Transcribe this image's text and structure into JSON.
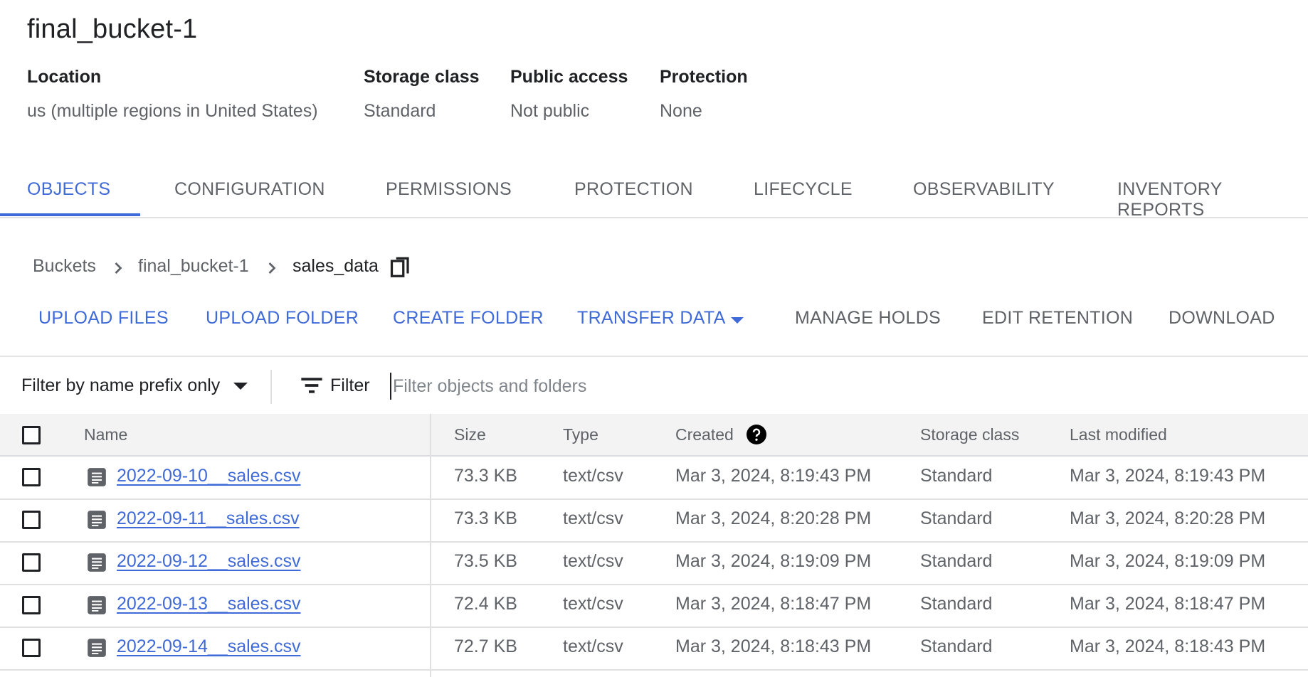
{
  "bucket": {
    "name": "final_bucket-1",
    "details": [
      {
        "label": "Location",
        "value": "us (multiple regions in United States)"
      },
      {
        "label": "Storage class",
        "value": "Standard"
      },
      {
        "label": "Public access",
        "value": "Not public"
      },
      {
        "label": "Protection",
        "value": "None"
      }
    ]
  },
  "tabs": [
    {
      "label": "OBJECTS",
      "active": true
    },
    {
      "label": "CONFIGURATION",
      "active": false
    },
    {
      "label": "PERMISSIONS",
      "active": false
    },
    {
      "label": "PROTECTION",
      "active": false
    },
    {
      "label": "LIFECYCLE",
      "active": false
    },
    {
      "label": "OBSERVABILITY",
      "active": false
    },
    {
      "label": "INVENTORY REPORTS",
      "active": false
    }
  ],
  "breadcrumb": {
    "items": [
      "Buckets",
      "final_bucket-1",
      "sales_data"
    ],
    "copy_icon": "copy-icon"
  },
  "actions": {
    "upload_files": "UPLOAD FILES",
    "upload_folder": "UPLOAD FOLDER",
    "create_folder": "CREATE FOLDER",
    "transfer_data": "TRANSFER DATA",
    "manage_holds": "MANAGE HOLDS",
    "edit_retention": "EDIT RETENTION",
    "download": "DOWNLOAD"
  },
  "filter": {
    "mode": "Filter by name prefix only",
    "label": "Filter",
    "placeholder": "Filter objects and folders",
    "value": ""
  },
  "table": {
    "headers": {
      "name": "Name",
      "size": "Size",
      "type": "Type",
      "created": "Created",
      "storage_class": "Storage class",
      "last_modified": "Last modified"
    },
    "rows": [
      {
        "name": "2022-09-10__sales.csv",
        "size": "73.3 KB",
        "type": "text/csv",
        "created": "Mar 3, 2024, 8:19:43 PM",
        "storage_class": "Standard",
        "last_modified": "Mar 3, 2024, 8:19:43 PM"
      },
      {
        "name": "2022-09-11__sales.csv",
        "size": "73.3 KB",
        "type": "text/csv",
        "created": "Mar 3, 2024, 8:20:28 PM",
        "storage_class": "Standard",
        "last_modified": "Mar 3, 2024, 8:20:28 PM"
      },
      {
        "name": "2022-09-12__sales.csv",
        "size": "73.5 KB",
        "type": "text/csv",
        "created": "Mar 3, 2024, 8:19:09 PM",
        "storage_class": "Standard",
        "last_modified": "Mar 3, 2024, 8:19:09 PM"
      },
      {
        "name": "2022-09-13__sales.csv",
        "size": "72.4 KB",
        "type": "text/csv",
        "created": "Mar 3, 2024, 8:18:47 PM",
        "storage_class": "Standard",
        "last_modified": "Mar 3, 2024, 8:18:47 PM"
      },
      {
        "name": "2022-09-14__sales.csv",
        "size": "72.7 KB",
        "type": "text/csv",
        "created": "Mar 3, 2024, 8:18:43 PM",
        "storage_class": "Standard",
        "last_modified": "Mar 3, 2024, 8:18:43 PM"
      }
    ]
  },
  "colors": {
    "accent": "#3f6ad8",
    "text_primary": "#202124",
    "text_secondary": "#5f6368",
    "header_bg": "#f3f3f3"
  }
}
